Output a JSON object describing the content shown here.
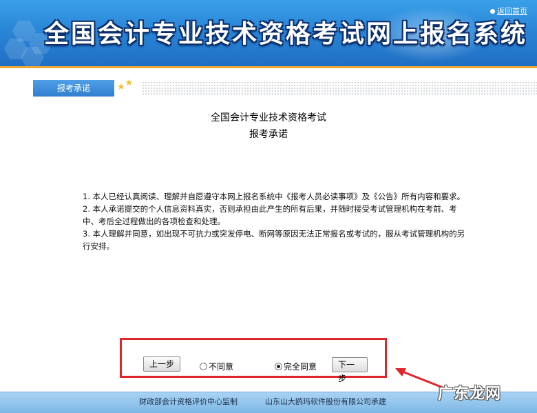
{
  "header": {
    "title": "全国会计专业技术资格考试网上报名系统",
    "home_link": "返回首页"
  },
  "tab": {
    "label": "报考承诺"
  },
  "content": {
    "title_line1": "全国会计专业技术资格考试",
    "title_line2": "报考承诺",
    "terms": [
      "1. 本人已经认真阅读、理解并自愿遵守本网上报名系统中《报考人员必读事项》及《公告》所有内容和要求。",
      "2. 本人承诺提交的个人信息资料真实，否则承担由此产生的所有后果，并随时接受考试管理机构在考前、考中、考后全过程做出的各项检查和处理。",
      "3. 本人理解并同意，如出现不可抗力或突发停电、断网等原因无法正常报名或考试的，服从考试管理机构的另行安排。"
    ]
  },
  "actions": {
    "prev_label": "上一步",
    "disagree_label": "不同意",
    "agree_label": "完全同意",
    "next_label": "下一步",
    "selected": "agree"
  },
  "footer": {
    "left": "财政部会计资格评价中心监制",
    "right": "山东山大鸥玛软件股份有限公司承建"
  },
  "watermark": {
    "text": "广东龙网"
  },
  "colors": {
    "banner": "#2a86d8",
    "accent_orange": "#f0a830",
    "highlight_red": "#e0262a",
    "footer": "#8fc4ec"
  }
}
